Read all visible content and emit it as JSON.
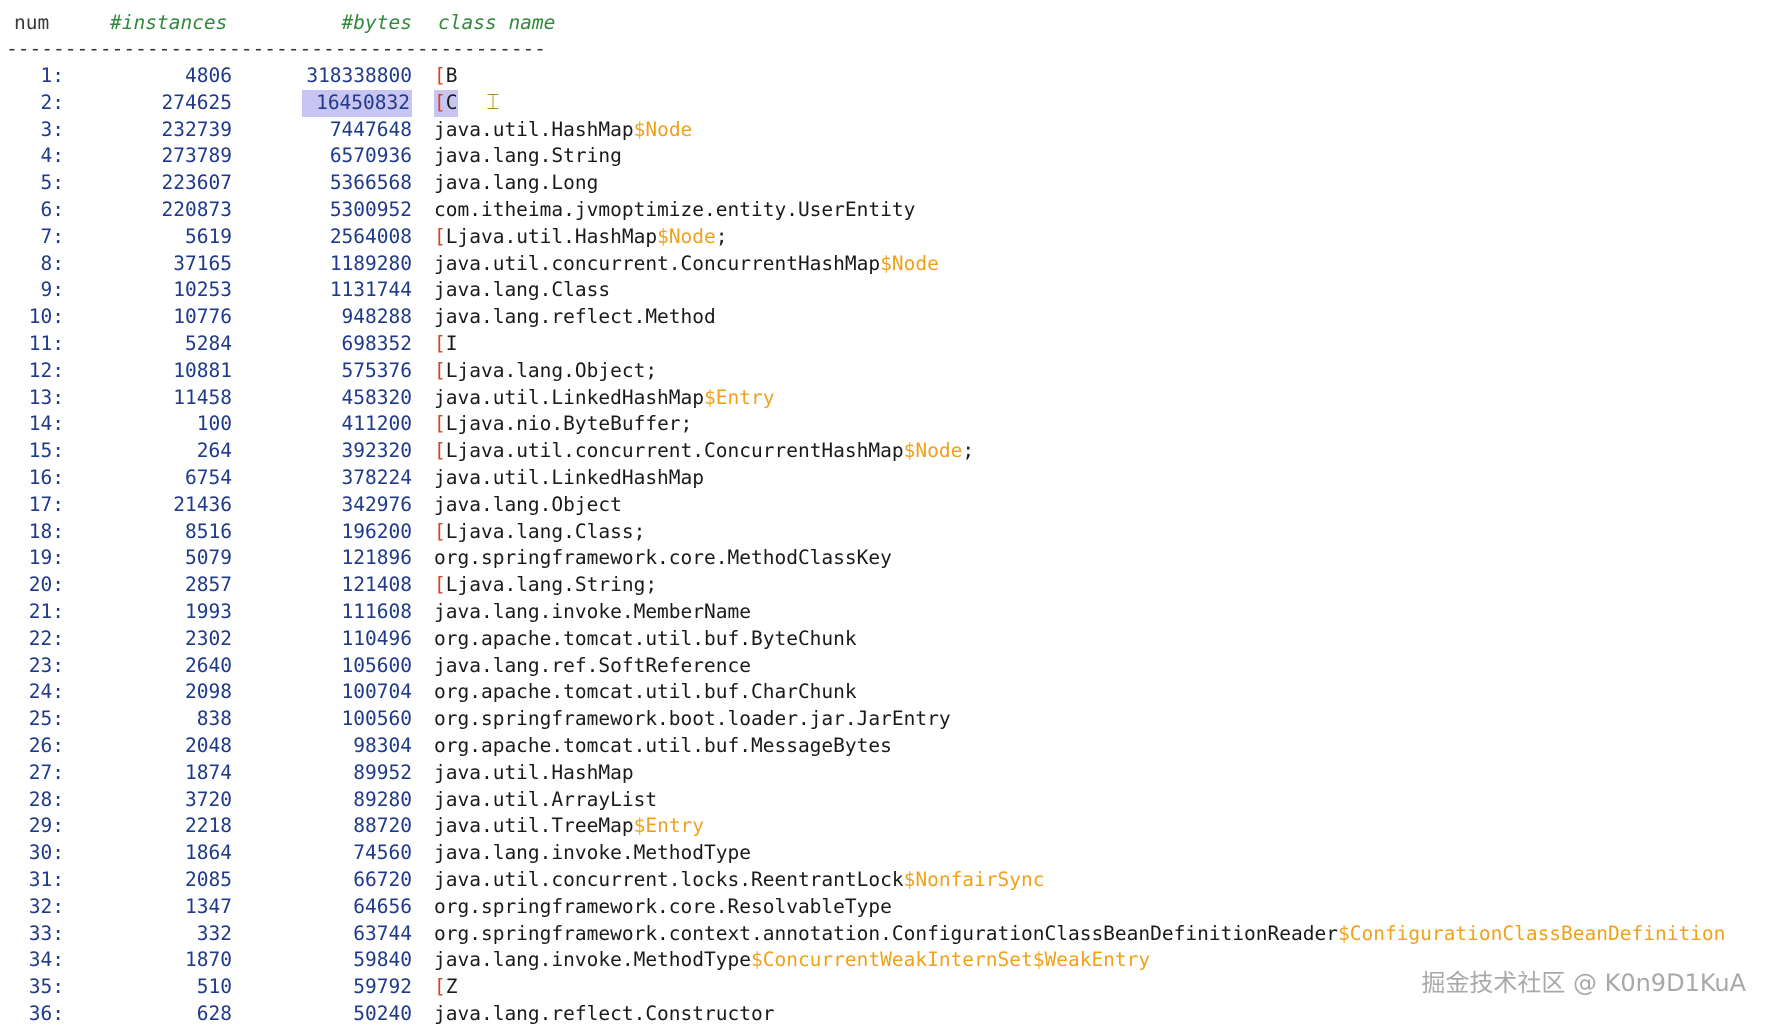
{
  "header": {
    "num": "num",
    "instances": "#instances",
    "bytes": "#bytes",
    "class_name": "class name"
  },
  "separator": "----------------------------------------------",
  "highlighted_row": 2,
  "colors": {
    "row_number": "#1f3a8a",
    "array_bracket": "#d9431e",
    "inner_class": "#f0a11a",
    "header": "#2f8a3a",
    "selection": "#c9c5f2"
  },
  "rows": [
    {
      "num": "1:",
      "instances": "4806",
      "bytes": "318338800",
      "cls": [
        "[",
        "B",
        ""
      ]
    },
    {
      "num": "2:",
      "instances": "274625",
      "bytes": "16450832",
      "cls": [
        "[",
        "C",
        ""
      ]
    },
    {
      "num": "3:",
      "instances": "232739",
      "bytes": "7447648",
      "cls": [
        "",
        "java.util.HashMap",
        "$Node"
      ]
    },
    {
      "num": "4:",
      "instances": "273789",
      "bytes": "6570936",
      "cls": [
        "",
        "java.lang.String",
        ""
      ]
    },
    {
      "num": "5:",
      "instances": "223607",
      "bytes": "5366568",
      "cls": [
        "",
        "java.lang.Long",
        ""
      ]
    },
    {
      "num": "6:",
      "instances": "220873",
      "bytes": "5300952",
      "cls": [
        "",
        "com.itheima.jvmoptimize.entity.UserEntity",
        ""
      ]
    },
    {
      "num": "7:",
      "instances": "5619",
      "bytes": "2564008",
      "cls": [
        "[",
        "Ljava.util.HashMap",
        "$Node",
        ";"
      ]
    },
    {
      "num": "8:",
      "instances": "37165",
      "bytes": "1189280",
      "cls": [
        "",
        "java.util.concurrent.ConcurrentHashMap",
        "$Node"
      ]
    },
    {
      "num": "9:",
      "instances": "10253",
      "bytes": "1131744",
      "cls": [
        "",
        "java.lang.Class",
        ""
      ]
    },
    {
      "num": "10:",
      "instances": "10776",
      "bytes": "948288",
      "cls": [
        "",
        "java.lang.reflect.Method",
        ""
      ]
    },
    {
      "num": "11:",
      "instances": "5284",
      "bytes": "698352",
      "cls": [
        "[",
        "I",
        ""
      ]
    },
    {
      "num": "12:",
      "instances": "10881",
      "bytes": "575376",
      "cls": [
        "[",
        "Ljava.lang.Object;",
        ""
      ]
    },
    {
      "num": "13:",
      "instances": "11458",
      "bytes": "458320",
      "cls": [
        "",
        "java.util.LinkedHashMap",
        "$Entry"
      ]
    },
    {
      "num": "14:",
      "instances": "100",
      "bytes": "411200",
      "cls": [
        "[",
        "Ljava.nio.ByteBuffer;",
        ""
      ]
    },
    {
      "num": "15:",
      "instances": "264",
      "bytes": "392320",
      "cls": [
        "[",
        "Ljava.util.concurrent.ConcurrentHashMap",
        "$Node",
        ";"
      ]
    },
    {
      "num": "16:",
      "instances": "6754",
      "bytes": "378224",
      "cls": [
        "",
        "java.util.LinkedHashMap",
        ""
      ]
    },
    {
      "num": "17:",
      "instances": "21436",
      "bytes": "342976",
      "cls": [
        "",
        "java.lang.Object",
        ""
      ]
    },
    {
      "num": "18:",
      "instances": "8516",
      "bytes": "196200",
      "cls": [
        "[",
        "Ljava.lang.Class;",
        ""
      ]
    },
    {
      "num": "19:",
      "instances": "5079",
      "bytes": "121896",
      "cls": [
        "",
        "org.springframework.core.MethodClassKey",
        ""
      ]
    },
    {
      "num": "20:",
      "instances": "2857",
      "bytes": "121408",
      "cls": [
        "[",
        "Ljava.lang.String;",
        ""
      ]
    },
    {
      "num": "21:",
      "instances": "1993",
      "bytes": "111608",
      "cls": [
        "",
        "java.lang.invoke.MemberName",
        ""
      ]
    },
    {
      "num": "22:",
      "instances": "2302",
      "bytes": "110496",
      "cls": [
        "",
        "org.apache.tomcat.util.buf.ByteChunk",
        ""
      ]
    },
    {
      "num": "23:",
      "instances": "2640",
      "bytes": "105600",
      "cls": [
        "",
        "java.lang.ref.SoftReference",
        ""
      ]
    },
    {
      "num": "24:",
      "instances": "2098",
      "bytes": "100704",
      "cls": [
        "",
        "org.apache.tomcat.util.buf.CharChunk",
        ""
      ]
    },
    {
      "num": "25:",
      "instances": "838",
      "bytes": "100560",
      "cls": [
        "",
        "org.springframework.boot.loader.jar.JarEntry",
        ""
      ]
    },
    {
      "num": "26:",
      "instances": "2048",
      "bytes": "98304",
      "cls": [
        "",
        "org.apache.tomcat.util.buf.MessageBytes",
        ""
      ]
    },
    {
      "num": "27:",
      "instances": "1874",
      "bytes": "89952",
      "cls": [
        "",
        "java.util.HashMap",
        ""
      ]
    },
    {
      "num": "28:",
      "instances": "3720",
      "bytes": "89280",
      "cls": [
        "",
        "java.util.ArrayList",
        ""
      ]
    },
    {
      "num": "29:",
      "instances": "2218",
      "bytes": "88720",
      "cls": [
        "",
        "java.util.TreeMap",
        "$Entry"
      ]
    },
    {
      "num": "30:",
      "instances": "1864",
      "bytes": "74560",
      "cls": [
        "",
        "java.lang.invoke.MethodType",
        ""
      ]
    },
    {
      "num": "31:",
      "instances": "2085",
      "bytes": "66720",
      "cls": [
        "",
        "java.util.concurrent.locks.ReentrantLock",
        "$NonfairSync"
      ]
    },
    {
      "num": "32:",
      "instances": "1347",
      "bytes": "64656",
      "cls": [
        "",
        "org.springframework.core.ResolvableType",
        ""
      ]
    },
    {
      "num": "33:",
      "instances": "332",
      "bytes": "63744",
      "cls": [
        "",
        "org.springframework.context.annotation.ConfigurationClassBeanDefinitionReader",
        "$ConfigurationClassBeanDefinition"
      ]
    },
    {
      "num": "34:",
      "instances": "1870",
      "bytes": "59840",
      "cls": [
        "",
        "java.lang.invoke.MethodType",
        "$ConcurrentWeakInternSet$WeakEntry"
      ]
    },
    {
      "num": "35:",
      "instances": "510",
      "bytes": "59792",
      "cls": [
        "[",
        "Z",
        ""
      ]
    },
    {
      "num": "36:",
      "instances": "628",
      "bytes": "50240",
      "cls": [
        "",
        "java.lang.reflect.Constructor",
        ""
      ]
    }
  ],
  "watermark": "掘金技术社区 @ K0n9D1KuA"
}
